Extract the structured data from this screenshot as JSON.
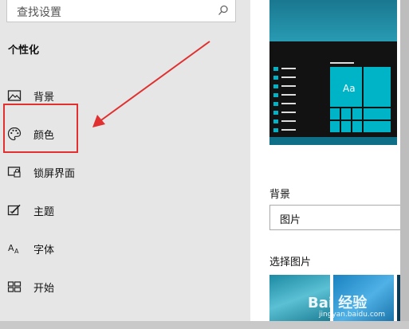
{
  "search": {
    "placeholder": "查找设置"
  },
  "sidebar": {
    "section_title": "个性化",
    "items": [
      {
        "label": "背景",
        "icon": "image-icon"
      },
      {
        "label": "颜色",
        "icon": "palette-icon"
      },
      {
        "label": "锁屏界面",
        "icon": "lock-screen-icon"
      },
      {
        "label": "主题",
        "icon": "theme-icon"
      },
      {
        "label": "字体",
        "icon": "font-icon"
      },
      {
        "label": "开始",
        "icon": "start-icon"
      }
    ]
  },
  "main": {
    "background_heading": "背景",
    "background_select_value": "图片",
    "choose_picture_heading": "选择图片",
    "preview_tile_text": "Aa"
  },
  "watermark": {
    "text": "Bai 经验",
    "sub": "jingyan.baidu.com"
  },
  "colors": {
    "accent": "#00b4c8",
    "annotation": "#e03030"
  }
}
